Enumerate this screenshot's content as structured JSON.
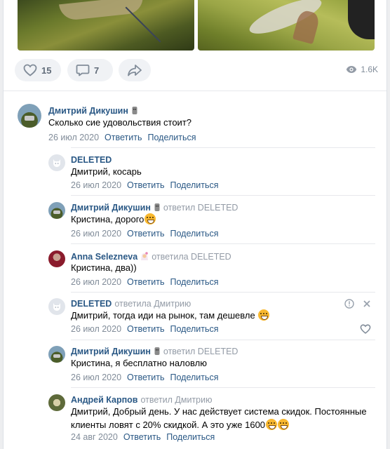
{
  "post": {
    "likes": "15",
    "comments": "7",
    "views": "1.6K"
  },
  "comments": [
    {
      "author": "Дмитрий Дикушин",
      "replied": "",
      "addressee": "",
      "text": "Сколько сие удовольствия стоит?",
      "date": "26 июл 2020",
      "reply_label": "Ответить",
      "share_label": "Поделиться"
    },
    {
      "author": "DELETED",
      "replied": "",
      "addressee": "Дмитрий",
      "text": ", косарь",
      "date": "26 июл 2020",
      "reply_label": "Ответить",
      "share_label": "Поделиться"
    },
    {
      "author": "Дмитрий Дикушин",
      "replied": "ответил DELETED",
      "addressee": "Кристина",
      "text": ", дорого",
      "date": "26 июл 2020",
      "reply_label": "Ответить",
      "share_label": "Поделиться"
    },
    {
      "author": "Anna Selezneva",
      "replied": "ответила DELETED",
      "addressee": "Кристина",
      "text": ", два))",
      "date": "26 июл 2020",
      "reply_label": "Ответить",
      "share_label": "Поделиться"
    },
    {
      "author": "DELETED",
      "replied": "ответила Дмитрию",
      "addressee": "Дмитрий",
      "text": ", тогда иди на рынок, там дешевле",
      "date": "26 июл 2020",
      "reply_label": "Ответить",
      "share_label": "Поделиться"
    },
    {
      "author": "Дмитрий Дикушин",
      "replied": "ответил DELETED",
      "addressee": "Кристина",
      "text": ", я бесплатно наловлю",
      "date": "26 июл 2020",
      "reply_label": "Ответить",
      "share_label": "Поделиться"
    },
    {
      "author": "Андрей Карпов",
      "replied": "ответил Дмитрию",
      "addressee": "Дмитрий",
      "text": ", Добрый день. У нас действует система скидок. Постоянные",
      "text2": "клиенты ловят с 20% скидкой. А это уже 1600",
      "date": "24 авг 2020",
      "reply_label": "Ответить",
      "share_label": "Поделиться"
    }
  ],
  "colors": {
    "link": "#2a5885",
    "muted": "#818c99",
    "pill_bg": "#f0f2f5"
  }
}
